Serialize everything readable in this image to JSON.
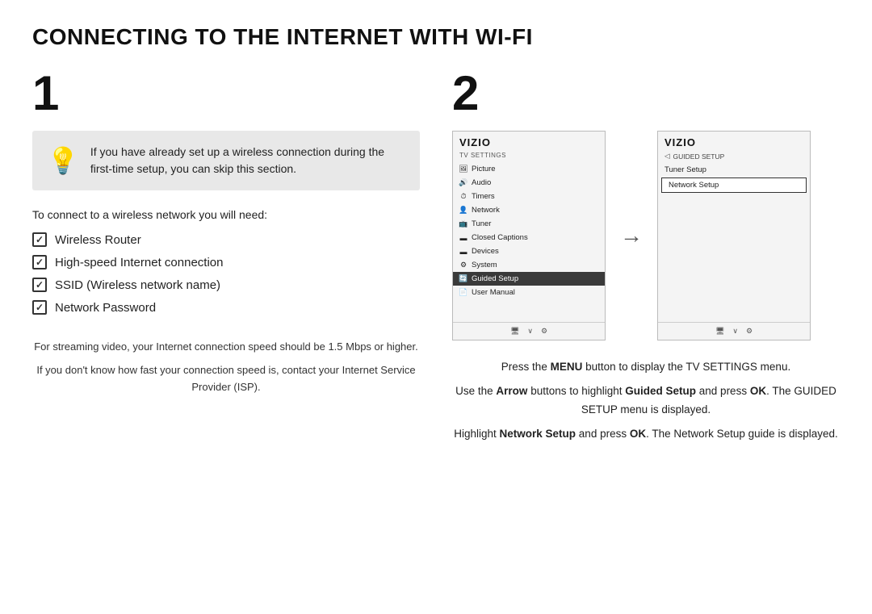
{
  "page": {
    "title": "CONNECTING TO THE INTERNET WITH Wi-Fi"
  },
  "step1": {
    "number": "1",
    "info_box": {
      "text": "If you have already set up a wireless connection during the first-time setup, you can skip this section."
    },
    "need_intro": "To connect to a wireless network you will need:",
    "checklist": [
      "Wireless Router",
      "High-speed Internet connection",
      "SSID (Wireless network name)",
      "Network Password"
    ],
    "footnotes": [
      "For streaming video, your Internet connection speed should be 1.5 Mbps or higher.",
      "If you don't know how fast your connection speed is, contact your Internet Service Provider (ISP)."
    ]
  },
  "step2": {
    "number": "2",
    "screen_left": {
      "brand": "VIZIO",
      "section": "TV SETTINGS",
      "items": [
        {
          "icon": "🖼",
          "label": "Picture",
          "highlighted": false
        },
        {
          "icon": "🔊",
          "label": "Audio",
          "highlighted": false
        },
        {
          "icon": "⏱",
          "label": "Timers",
          "highlighted": false
        },
        {
          "icon": "📶",
          "label": "Network",
          "highlighted": false
        },
        {
          "icon": "📺",
          "label": "Tuner",
          "highlighted": false
        },
        {
          "icon": "▬",
          "label": "Closed Captions",
          "highlighted": false
        },
        {
          "icon": "▬",
          "label": "Devices",
          "highlighted": false
        },
        {
          "icon": "⚙",
          "label": "System",
          "highlighted": false
        },
        {
          "icon": "🔄",
          "label": "Guided Setup",
          "highlighted": true
        },
        {
          "icon": "📄",
          "label": "User Manual",
          "highlighted": false
        }
      ],
      "bottom": [
        "🖥",
        "∨",
        "⚙"
      ]
    },
    "screen_right": {
      "brand": "VIZIO",
      "section": "GUIDED SETUP",
      "items": [
        {
          "label": "Tuner Setup",
          "selected": false
        },
        {
          "label": "Network Setup",
          "selected": true
        }
      ],
      "bottom": [
        "🖥",
        "∨",
        "⚙"
      ]
    },
    "description": [
      "Press the <b>MENU</b> button to display the TV SETTINGS menu.",
      "Use the <b>Arrow</b> buttons to highlight <b>Guided Setup</b> and press <b>OK</b>. The GUIDED SETUP menu is displayed.",
      "Highlight <b>Network Setup</b> and press <b>OK</b>. The Network Setup guide is displayed."
    ]
  }
}
